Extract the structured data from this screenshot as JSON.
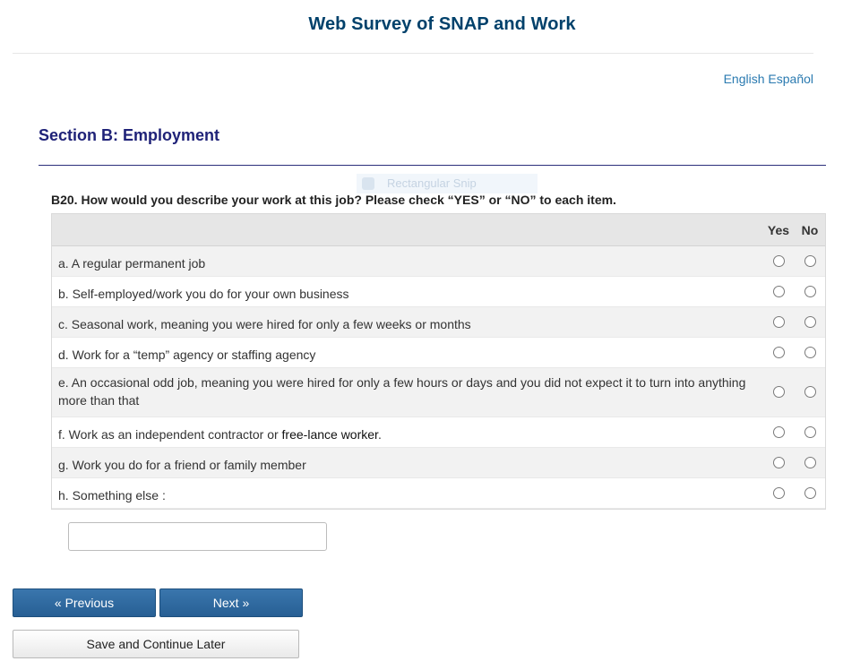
{
  "header": {
    "title": "Web Survey of SNAP and Work"
  },
  "language": {
    "english": "English",
    "spanish": "Español"
  },
  "section": {
    "heading": "Section B: Employment"
  },
  "overlay": {
    "text": "Rectangular Snip"
  },
  "question": {
    "text": "B20. How would you describe your work at this job? Please check “YES” or “NO” to each item.",
    "columns": {
      "yes": "Yes",
      "no": "No"
    },
    "items": [
      {
        "label": "a. A regular permanent job"
      },
      {
        "label": "b. Self-employed/work you do for your own business"
      },
      {
        "label": "c. Seasonal work, meaning you were hired for only a few weeks or months"
      },
      {
        "label": "d. Work for a “temp” agency or staffing agency"
      },
      {
        "label": "e. An occasional odd job, meaning you were hired for only a few hours or days and you did not expect it to turn into anything more than that"
      },
      {
        "label_prefix": "f. Work as an independent contractor or ",
        "label_dark": "free-lance worker",
        "label_suffix": "."
      },
      {
        "label": "g. Work you do for a friend or family member"
      },
      {
        "label": "h. Something else :"
      }
    ],
    "other_value": ""
  },
  "navigation": {
    "previous_label": "« Previous",
    "next_label": "Next »",
    "save_label": "Save and Continue Later"
  },
  "colors": {
    "title": "#00416b",
    "section_heading": "#1f2278",
    "link": "#2a7ab0",
    "button_primary": "#2f6a9f"
  }
}
